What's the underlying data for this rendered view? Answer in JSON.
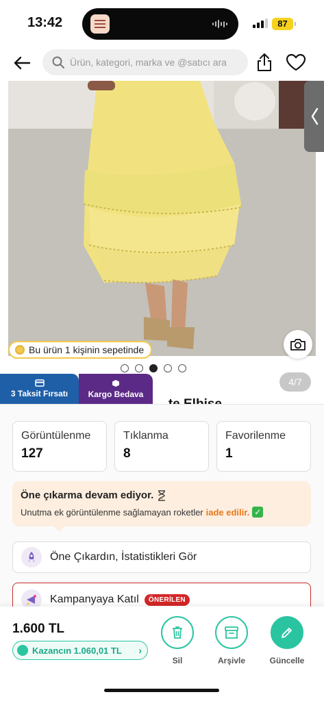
{
  "status_bar": {
    "time": "13:42",
    "battery": "87"
  },
  "header": {
    "search_placeholder": "Ürün, kategori, marka ve @satıcı ara"
  },
  "product": {
    "basket_badge": "Bu ürün 1 kişinin sepetinde",
    "image_index": "4/7",
    "title_peek": "...te Elbise",
    "gallery_dots": 5,
    "gallery_active": 3
  },
  "tabs": {
    "taksit": "3 Taksit Fırsatı",
    "kargo": "Kargo Bedava"
  },
  "stats": [
    {
      "label": "Görüntülenme",
      "value": "127"
    },
    {
      "label": "Tıklanma",
      "value": "8"
    },
    {
      "label": "Favorilenme",
      "value": "1"
    }
  ],
  "boost": {
    "title": "Öne çıkarma devam ediyor.",
    "text": "Unutma ek görüntülenme sağlamayan roketler",
    "link": "iade edilir."
  },
  "actions": {
    "stats_label": "Öne Çıkardın, İstatistikleri Gör",
    "campaign_label": "Kampanyaya Katıl",
    "campaign_badge": "ÖNERİLEN"
  },
  "bottom": {
    "price": "1.600 TL",
    "earnings": "Kazancın 1.060,01 TL",
    "delete_label": "Sil",
    "archive_label": "Arşivle",
    "update_label": "Güncelle"
  },
  "colors": {
    "accent": "#2bc4a1",
    "taksit_tab": "#1f5fa8",
    "kargo_tab": "#5b2a86",
    "badge_red": "#d32626",
    "link_orange": "#e8791a"
  }
}
